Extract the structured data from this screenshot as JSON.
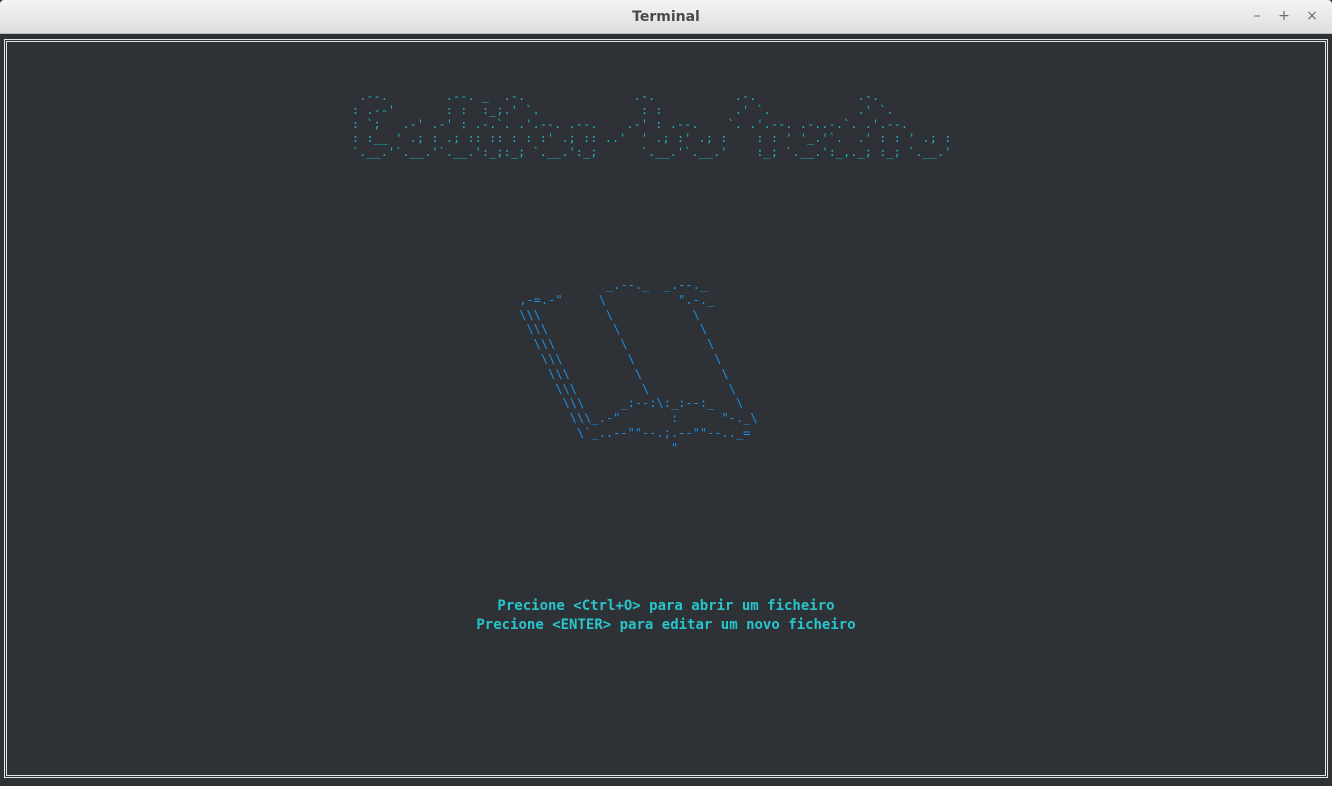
{
  "window": {
    "title": "Terminal",
    "controls": {
      "minimize": "–",
      "maximize": "+",
      "close": "×"
    }
  },
  "screen": {
    "banner_ascii": " .--.        .--. _  .-.               .-.           .-.              .-.\n: .--'       : :  :_;.' `.              : :          .' `.            .' `.\n: `;   .-' .-' : .-.`. .'.--. .--.    .-' : .--.    `. .'.--. .-..-.`. .'.--.\n: :__ ' .; : .; :: :: : : :' .; :: ..'  ' .; :' .; :    : : ' '_.'`.  .' : : ' .; :\n`.__.'`.__.'`.__.':_;:_; `.__.':_;      `.__.'`.__.'    :_; `.__.':_,._; :_; `.__.'",
    "book_ascii": "             _.--._  _.--._\n ,-=.-\"     \\          \".-._\n \\\\\\         \\           \\\n  \\\\\\         \\           \\\n   \\\\\\         \\           \\\n    \\\\\\         \\           \\\n     \\\\\\         \\           \\\n      \\\\\\         \\           \\\n       \\\\\\     _:--:\\:_:--:_   \\\n        \\\\\\_.-\"       :      \"-._\\\n         \\`_..--\"\"--.;.--\"\"--.._=\n                      \"",
    "prompt_open": "Precione <Ctrl+O> para abrir um ficheiro",
    "prompt_new": "Precione <ENTER> para editar um novo ficheiro"
  },
  "colors": {
    "background": "#2e3236",
    "banner": "#1fb8c9",
    "book": "#1e8fe0",
    "prompt_text": "#27c6cc",
    "frame": "#e6e6e6"
  }
}
